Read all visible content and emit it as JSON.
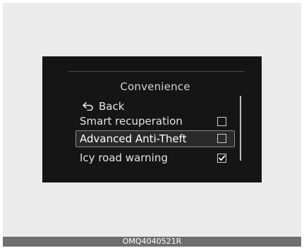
{
  "screen": {
    "title": "Convenience",
    "back_label": "Back",
    "items": [
      {
        "label": "Smart recuperation",
        "checked": false,
        "selected": false
      },
      {
        "label": "Advanced Anti-Theft",
        "checked": false,
        "selected": true
      },
      {
        "label": "Icy road warning",
        "checked": true,
        "selected": false
      }
    ]
  },
  "icons": {
    "back": "back-arrow-icon",
    "checkbox": "checkbox-icon",
    "checkmark": "checkmark-icon"
  },
  "colors": {
    "screen_bg": "#151515",
    "text": "#e2e2e2",
    "selection_border": "#8a8a8a",
    "footer_bg": "#6e6e6e"
  },
  "footer": {
    "code": "OMQ4040521R"
  }
}
